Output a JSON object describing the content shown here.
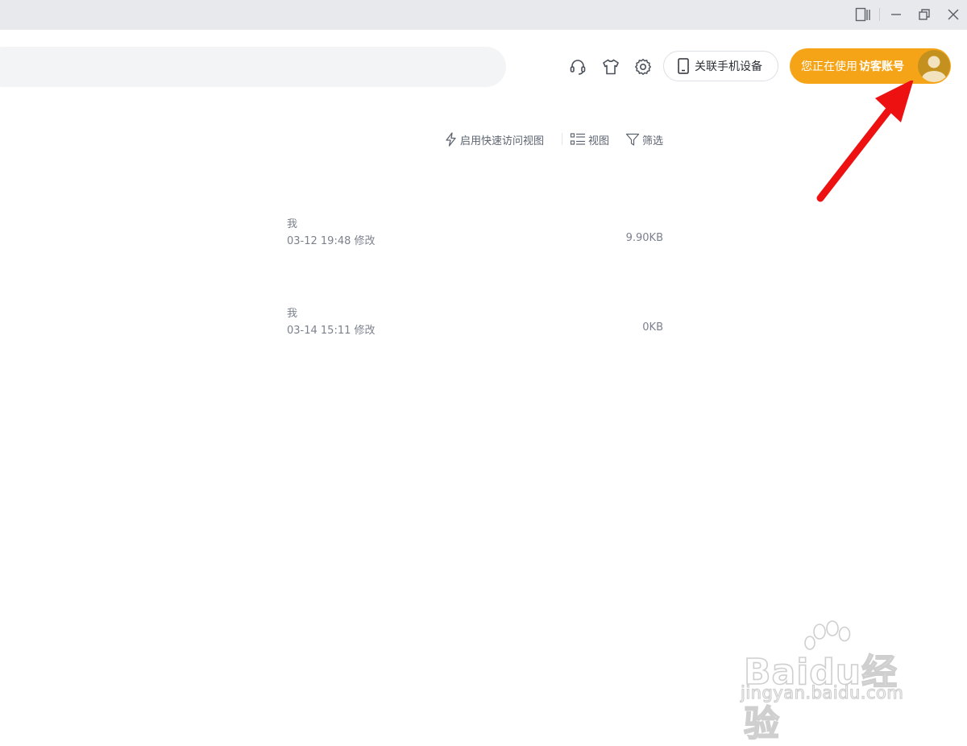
{
  "header": {
    "phone_button_label": "关联手机设备",
    "account_prefix": "您正在使用",
    "account_name": "访客账号"
  },
  "toolbar": {
    "quick_access_label": "启用快速访问视图",
    "view_label": "视图",
    "filter_label": "筛选"
  },
  "files": [
    {
      "owner": "我",
      "modified": "03-12 19:48 修改",
      "size": "9.90KB"
    },
    {
      "owner": "我",
      "modified": "03-14 15:11 修改",
      "size": "0KB"
    }
  ],
  "watermark": {
    "brand": "Baidu经验",
    "url": "jingyan.baidu.com"
  },
  "colors": {
    "accent": "#f5a418",
    "annotation_arrow": "#ee1111",
    "titlebar": "#e8e9ec"
  },
  "icons": [
    "sidebar-toggle-icon",
    "minimize-icon",
    "restore-icon",
    "close-icon",
    "headset-icon",
    "tshirt-icon",
    "gear-icon",
    "phone-icon",
    "avatar",
    "lightning-icon",
    "list-view-icon",
    "filter-icon"
  ]
}
